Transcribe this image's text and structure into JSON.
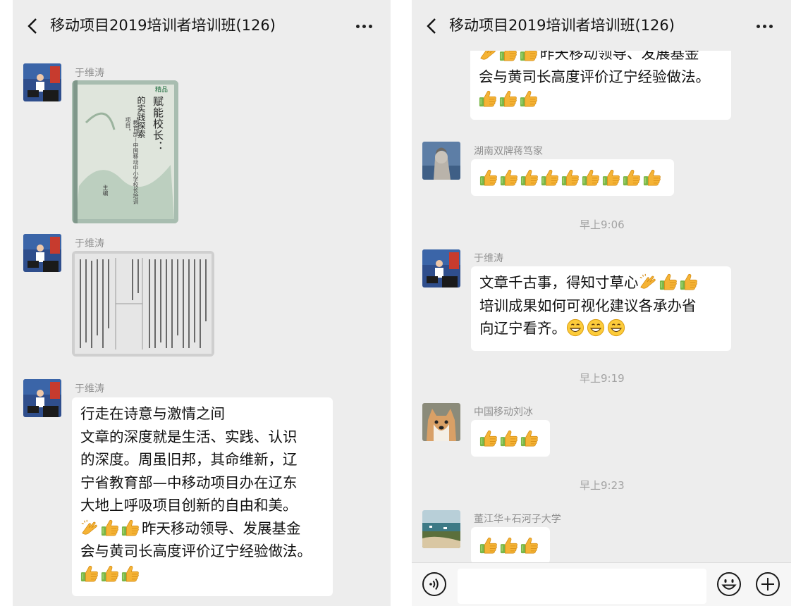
{
  "left": {
    "title": "移动项目2019培训者培训班(126)",
    "messages": [
      {
        "sender": "于维涛",
        "book": {
          "top_mark": "精品",
          "title_line1": "赋能校长：",
          "title_line2": "的实践探索",
          "subtitle": "“教育部－中国移动中小学校长培训项目”",
          "author": "主编"
        }
      },
      {
        "sender": "于维涛"
      },
      {
        "sender": "于维涛",
        "text": {
          "line1": "行走在诗意与激情之间",
          "line2": "文章的深度就是生活、实践、认识",
          "line3": "的深度。周虽旧邦，其命维新，辽",
          "line4": "宁省教育部—中移动项目办在辽东",
          "line5": "大地上呼吸项目创新的自由和美。",
          "line6": "昨天移动领导、发展基金",
          "line7": "会与黄司长高度评价辽宁经验做法。"
        }
      }
    ]
  },
  "right": {
    "title": "移动项目2019培训者培训班(126)",
    "continued": {
      "line1": "昨天移动领导、发展基金",
      "line2": "会与黄司长高度评价辽宁经验做法。"
    },
    "messages": [
      {
        "sender": "湖南双牌蒋笃家"
      },
      {
        "sender": "于维涛",
        "line1": "文章千古事，得知寸草心",
        "line2": "培训成果如何可视化建议各承办省",
        "line3": "向辽宁看齐。"
      },
      {
        "sender": "中国移动刘冰"
      },
      {
        "sender": "董江华+石河子大学"
      }
    ],
    "times": [
      "早上9:06",
      "早上9:19",
      "早上9:23"
    ],
    "input": {
      "placeholder": ""
    }
  },
  "icons": {
    "back": "chevron-left-icon",
    "more": "more-dots-icon",
    "thumbs": "thumbs-up-emoji",
    "clap": "clap-hands-emoji",
    "grin": "grinning-face-emoji",
    "voice": "voice-icon",
    "emoji": "smiley-icon",
    "plus": "plus-icon"
  },
  "colors": {
    "background": "#ededed",
    "bubble": "#ffffff",
    "sender": "#8f8f8f",
    "time": "#a3a3a3",
    "thumb": "#f5b335",
    "cuff": "#7ab648"
  }
}
